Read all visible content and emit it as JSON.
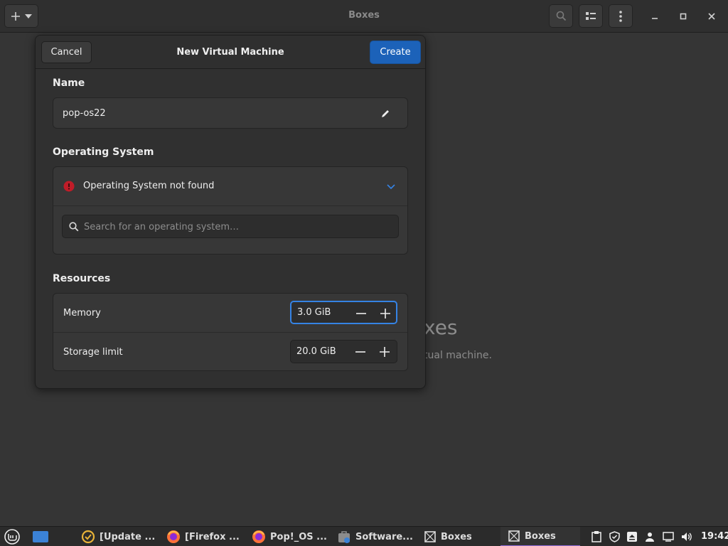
{
  "app": {
    "title": "Boxes"
  },
  "background": {
    "title_fragment": "xes",
    "subtitle_fragment": "tual machine."
  },
  "dialog": {
    "title": "New Virtual Machine",
    "cancel_label": "Cancel",
    "create_label": "Create",
    "name_section": {
      "label": "Name",
      "value": "pop-os22"
    },
    "os_section": {
      "label": "Operating System",
      "status_text": "Operating System not found",
      "search_placeholder": "Search for an operating system…"
    },
    "resources_section": {
      "label": "Resources",
      "memory": {
        "label": "Memory",
        "value": "3.0 GiB"
      },
      "storage": {
        "label": "Storage limit",
        "value": "20.0 GiB"
      }
    }
  },
  "taskbar": {
    "tasks": [
      {
        "label": "[Update ...",
        "icon": "update-manager-icon"
      },
      {
        "label": "[Firefox ...",
        "icon": "firefox-icon"
      },
      {
        "label": "Pop!_OS ...",
        "icon": "firefox-icon"
      },
      {
        "label": "Software...",
        "icon": "software-manager-icon"
      },
      {
        "label": "Boxes",
        "icon": "boxes-icon"
      },
      {
        "label": "Boxes",
        "icon": "boxes-icon"
      }
    ],
    "clock": "19:42"
  },
  "colors": {
    "accent": "#1c62b9",
    "focus": "#3583e4",
    "error": "#c01c28",
    "active_task": "#8f6ad6"
  }
}
